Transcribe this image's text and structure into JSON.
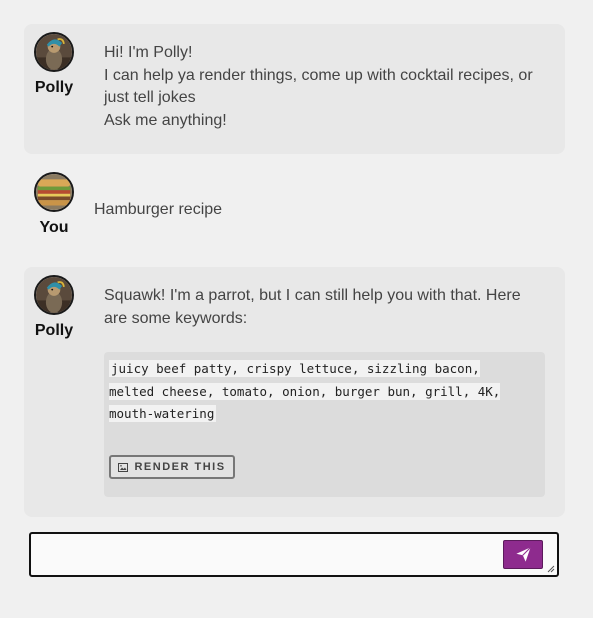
{
  "messages": [
    {
      "sender": "Polly",
      "avatar": "parrot-avatar",
      "lines": [
        "Hi! I'm Polly!",
        "I can help ya render things, come up with cocktail recipes, or just tell jokes",
        "Ask me anything!"
      ]
    },
    {
      "sender": "You",
      "avatar": "sandwich-avatar",
      "text": "Hamburger recipe"
    },
    {
      "sender": "Polly",
      "avatar": "parrot-avatar",
      "text": "Squawk! I'm a parrot, but I can still help you with that. Here are some keywords:",
      "code": "juicy beef patty, crispy lettuce, sizzling bacon, melted cheese, tomato, onion, burger bun, grill, 4K, mouth-watering",
      "render_button": "RENDER THIS"
    }
  ],
  "composer": {
    "value": "",
    "send_icon": "paper-plane-icon"
  },
  "colors": {
    "background": "#f0f0f0",
    "bot_bubble": "#e8e8e8",
    "code_box": "#dcdcdc",
    "send_button": "#8e2b8e"
  }
}
